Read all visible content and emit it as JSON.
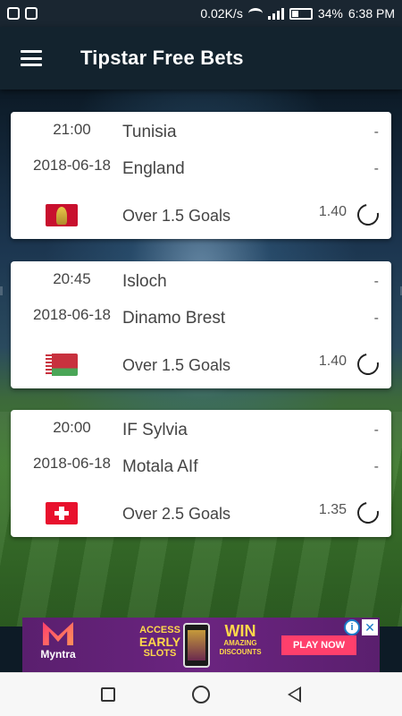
{
  "status_bar": {
    "network_speed": "0.02K/s",
    "battery": "34%",
    "time": "6:38 PM"
  },
  "app_bar": {
    "title": "Tipstar Free Bets"
  },
  "matches": [
    {
      "time": "21:00",
      "date": "2018-06-18",
      "home_team": "Tunisia",
      "away_team": "England",
      "home_score": "-",
      "away_score": "-",
      "tip": "Over 1.5 Goals",
      "odds": "1.40",
      "flag": "world-cup-flag-icon"
    },
    {
      "time": "20:45",
      "date": "2018-06-18",
      "home_team": "Isloch",
      "away_team": "Dinamo Brest",
      "home_score": "-",
      "away_score": "-",
      "tip": "Over 1.5 Goals",
      "odds": "1.40",
      "flag": "belarus-flag-icon"
    },
    {
      "time": "20:00",
      "date": "2018-06-18",
      "home_team": "IF Sylvia",
      "away_team": "Motala AIf",
      "home_score": "-",
      "away_score": "-",
      "tip": "Over 2.5 Goals",
      "odds": "1.35",
      "flag": "switzerland-flag-icon"
    }
  ],
  "ad": {
    "brand": "Myntra",
    "access_line1": "ACCESS",
    "access_line2": "EARLY",
    "access_line3": "SLOTS",
    "win": "WIN",
    "win_sub": "AMAZING DISCOUNTS",
    "cta": "PLAY NOW",
    "info": "i",
    "close": "✕"
  },
  "colors": {
    "app_bar": "#13232e",
    "status_bar": "#1a2631",
    "card": "#ffffff",
    "ad_bg": "#6b2480",
    "cta": "#ff3f6c"
  }
}
